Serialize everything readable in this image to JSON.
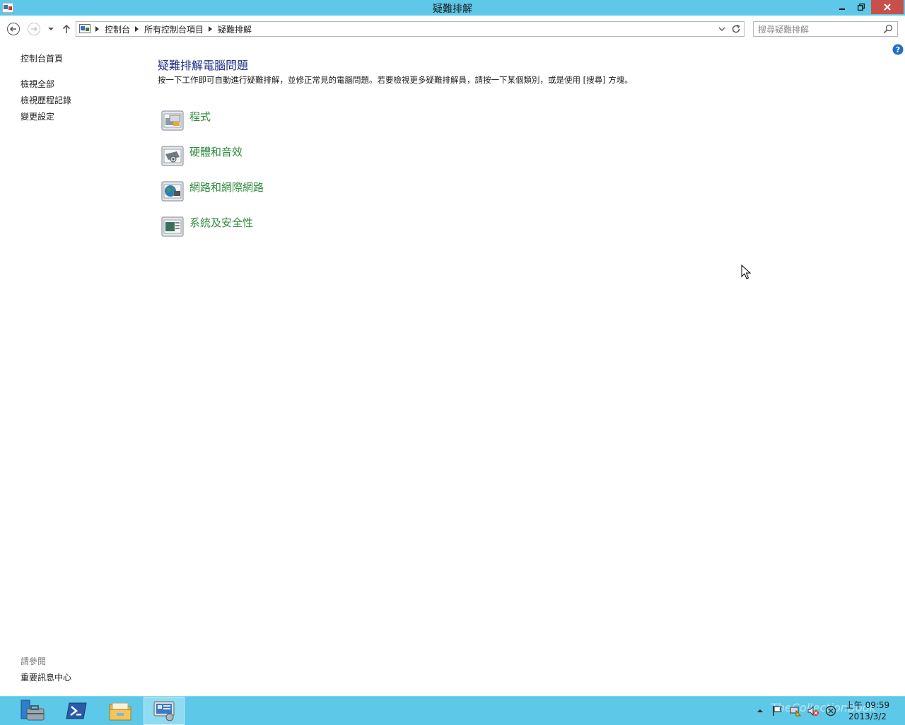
{
  "window": {
    "title": "疑難排解"
  },
  "address_bar": {
    "crumbs": [
      "控制台",
      "所有控制台項目",
      "疑難排解"
    ]
  },
  "search": {
    "placeholder": "搜尋疑難排解"
  },
  "left_pane": {
    "home_link": "控制台首頁",
    "links": [
      "檢視全部",
      "檢視歷程記錄",
      "變更設定"
    ],
    "see_also_heading": "請參閱",
    "see_also_links": [
      "重要訊息中心"
    ]
  },
  "main": {
    "title": "疑難排解電腦問題",
    "description": "按一下工作即可自動進行疑難排解，並修正常見的電腦問題。若要檢視更多疑難排解員，請按一下某個類別，或是使用 [搜尋] 方塊。",
    "categories": [
      {
        "label": "程式",
        "icon": "programs-icon"
      },
      {
        "label": "硬體和音效",
        "icon": "hardware-sound-icon"
      },
      {
        "label": "網路和網際網路",
        "icon": "network-internet-icon"
      },
      {
        "label": "系統及安全性",
        "icon": "system-security-icon"
      }
    ]
  },
  "taskbar": {
    "apps": [
      "server-manager-icon",
      "powershell-icon",
      "file-explorer-icon",
      "control-panel-icon"
    ],
    "clock_time": "上午 09:59",
    "clock_date": "2013/3/2",
    "watermark": "TheCollectionBook"
  },
  "colors": {
    "titlebar": "#5ec8e8",
    "link_green": "#2e8b3a",
    "heading_blue": "#1e3287"
  }
}
